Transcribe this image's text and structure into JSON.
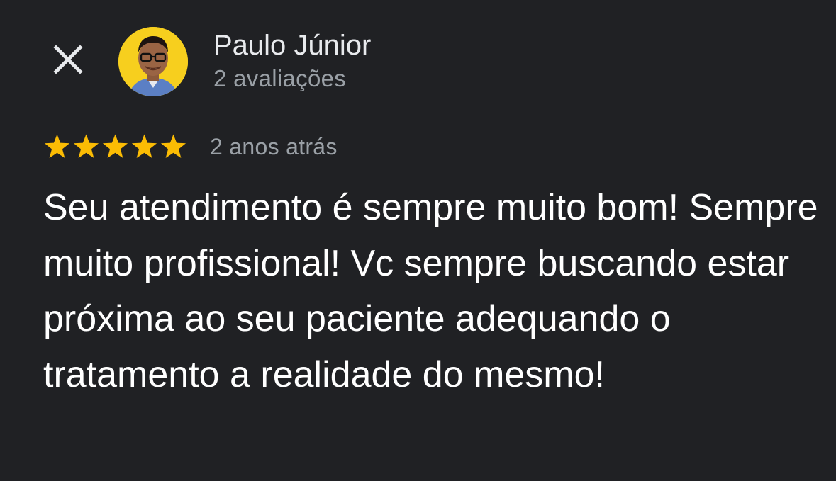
{
  "header": {
    "close_icon": "close-icon",
    "avatar_icon": "avatar"
  },
  "author": {
    "name": "Paulo Júnior",
    "review_count": "2 avaliações"
  },
  "review": {
    "rating": 5,
    "rating_max": 5,
    "star_color": "#fbbc04",
    "date": "2 anos atrás",
    "text": "Seu atendimento é sempre muito bom! Sempre muito profissional! Vc sempre buscando estar próxima ao seu paciente adequando o tratamento a realidade do mesmo!"
  },
  "colors": {
    "background": "#202124",
    "primary_text": "#e8eaed",
    "secondary_text": "#9aa0a6",
    "review_text": "#ffffff"
  }
}
